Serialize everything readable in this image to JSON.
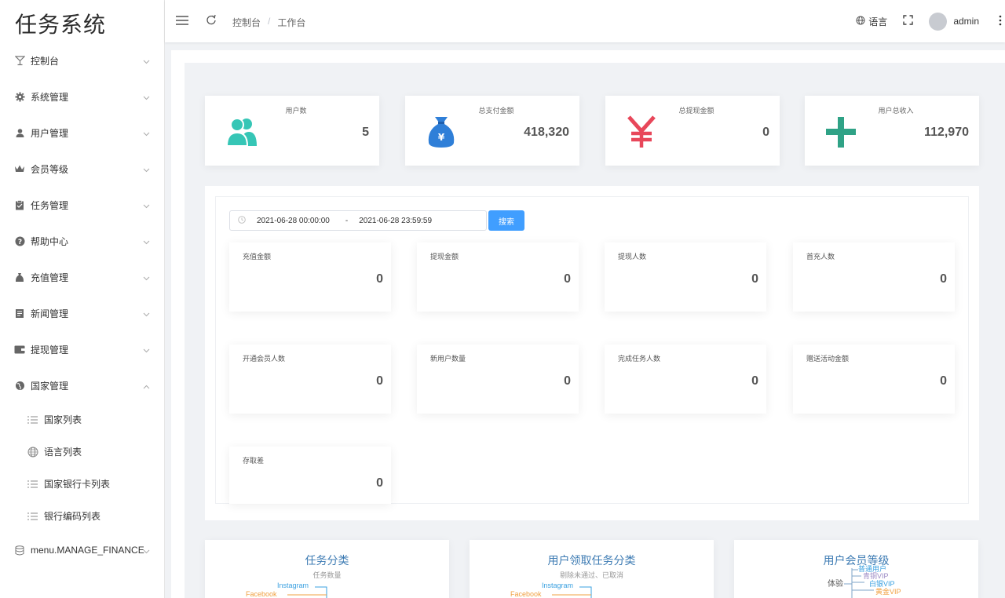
{
  "app": {
    "title": "任务系统"
  },
  "sidebar": {
    "items": [
      {
        "label": "控制台",
        "icon": "cocktail-icon"
      },
      {
        "label": "系统管理",
        "icon": "gear-icon"
      },
      {
        "label": "用户管理",
        "icon": "user-icon"
      },
      {
        "label": "会员等级",
        "icon": "crown-icon"
      },
      {
        "label": "任务管理",
        "icon": "clipboard-icon"
      },
      {
        "label": "帮助中心",
        "icon": "question-icon"
      },
      {
        "label": "充值管理",
        "icon": "money-bag-icon"
      },
      {
        "label": "新闻管理",
        "icon": "newspaper-icon"
      },
      {
        "label": "提现管理",
        "icon": "wallet-icon"
      },
      {
        "label": "国家管理",
        "icon": "globe-icon"
      }
    ],
    "sub_items": [
      {
        "label": "国家列表",
        "icon": "list-icon"
      },
      {
        "label": "语言列表",
        "icon": "globe-outline-icon"
      },
      {
        "label": "国家银行卡列表",
        "icon": "list-icon"
      },
      {
        "label": "银行编码列表",
        "icon": "list-icon"
      }
    ],
    "finance": {
      "label": "menu.MANAGE_FINANCE",
      "icon": "database-icon"
    }
  },
  "header": {
    "breadcrumb": [
      "控制台",
      "工作台"
    ],
    "language": "语言",
    "username": "admin"
  },
  "stats": [
    {
      "label": "用户数",
      "value": "5",
      "icon": "users-icon",
      "color": "#36c6b6"
    },
    {
      "label": "总支付金额",
      "value": "418,320",
      "icon": "money-bag-icon",
      "color": "#2f7fd8"
    },
    {
      "label": "总提现金额",
      "value": "0",
      "icon": "yen-icon",
      "color": "#e8475a"
    },
    {
      "label": "用户总收入",
      "value": "112,970",
      "icon": "plus-icon",
      "color": "#2fa286"
    }
  ],
  "filter": {
    "start": "2021-06-28 00:00:00",
    "separator": "-",
    "end": "2021-06-28 23:59:59",
    "search_label": "搜索"
  },
  "metrics": [
    {
      "label": "充值金额",
      "value": "0"
    },
    {
      "label": "提现金额",
      "value": "0"
    },
    {
      "label": "提现人数",
      "value": "0"
    },
    {
      "label": "首充人数",
      "value": "0"
    },
    {
      "label": "开通会员人数",
      "value": "0"
    },
    {
      "label": "新用户数量",
      "value": "0"
    },
    {
      "label": "完成任务人数",
      "value": "0"
    },
    {
      "label": "赠送活动金额",
      "value": "0"
    },
    {
      "label": "存取差",
      "value": "0"
    }
  ],
  "charts": [
    {
      "title": "任务分类",
      "subtitle": "任务数量",
      "labels": [
        "Instagram",
        "Facebook"
      ]
    },
    {
      "title": "用户领取任务分类",
      "subtitle": "剔除未通过、已取消",
      "labels": [
        "Instagram",
        "Facebook"
      ]
    },
    {
      "title": "用户会员等级",
      "subtitle": "",
      "labels": [
        "体验",
        "普通用户",
        "青铜VIP",
        "白银VIP",
        "黄金VIP"
      ]
    }
  ]
}
